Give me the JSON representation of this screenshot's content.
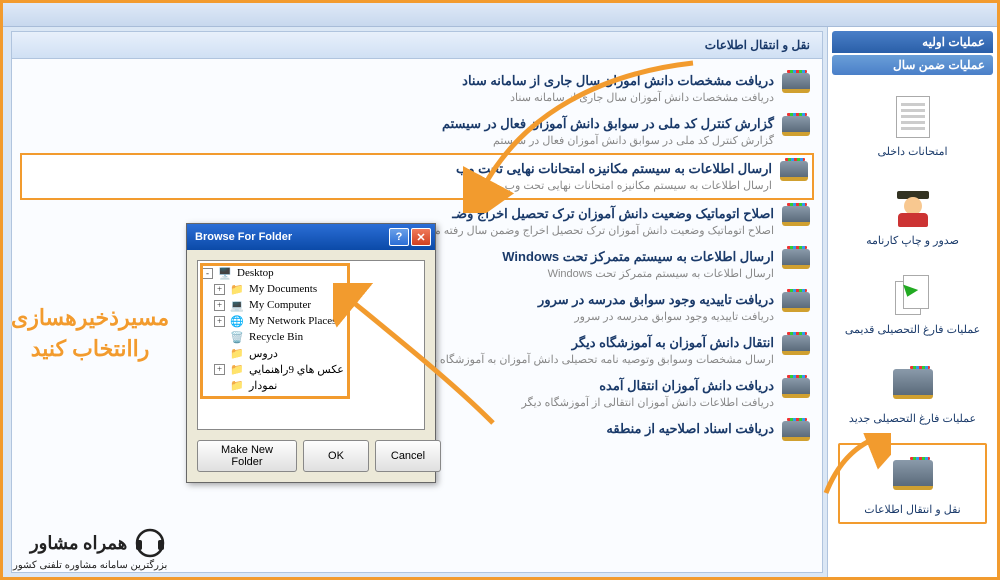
{
  "topbar": {},
  "sidebar": {
    "header1": "عملیات اولیه",
    "header2": "عملیات ضمن سال",
    "items": [
      {
        "label": "امتحانات داخلی"
      },
      {
        "label": "صدور و چاپ کارنامه"
      },
      {
        "label": "عملیات فارغ التحصیلی قدیمی"
      },
      {
        "label": "عملیات فارغ التحصیلی جدید"
      },
      {
        "label": "نقل و انتقال اطلاعات"
      }
    ]
  },
  "content": {
    "header": "نقل و انتقال اطلاعات",
    "items": [
      {
        "title": "دریافت مشخصات دانش آموزان سال جاری از سامانه سناد",
        "desc": "دریافت مشخصات دانش آموزان سال جاری از سامانه سناد"
      },
      {
        "title": "گزارش کنترل کد ملی در سوابق  دانش آموزان فعال در سیستم",
        "desc": "گزارش کنترل کد ملی در سوابق  دانش آموزان فعال در سیستم"
      },
      {
        "title": "ارسال اطلاعات به سیستم مکانیزه امتحانات نهایی تحت وب",
        "desc": "ارسال اطلاعات به سیستم مکانیزه امتحانات نهایی تحت وب"
      },
      {
        "title": "اصلاح اتوماتیک وضعیت دانش آموزان ترک تحصیل  اخراج وضـ",
        "desc": "اصلاح اتوماتیک وضعیت دانش آموزان ترک تحصیل  اخراج وضمن سال رفته مربوط به سالهای قبل"
      },
      {
        "title": "ارسال اطلاعات به سیستم متمرکز تحت Windows",
        "desc": "ارسال اطلاعات به سیستم متمرکز تحت Windows"
      },
      {
        "title": "دریافت تاییدیه وجود سوابق مدرسه در سرور",
        "desc": "دریافت تاییدیه وجود سوابق مدرسه در سرور"
      },
      {
        "title": "انتقال دانش آموزان به آموزشگاه دیگر",
        "desc": "ارسال مشخصات وسوابق وتوصیه نامه تحصیلی دانش آموزان به آموزشگاه دیگر"
      },
      {
        "title": "دریافت دانش آموزان انتقال آمده",
        "desc": "دریافت  اطلاعات دانش آموزان انتقالی از آموزشگاه دیگر"
      },
      {
        "title": "دریافت اسناد اصلاحیه از منطقه",
        "desc": ""
      }
    ]
  },
  "dialog": {
    "title": "Browse For Folder",
    "tree": [
      {
        "label": "Desktop",
        "expander": "-",
        "indent": 0,
        "icon": "desktop"
      },
      {
        "label": "My Documents",
        "expander": "+",
        "indent": 1,
        "icon": "folder"
      },
      {
        "label": "My Computer",
        "expander": "+",
        "indent": 1,
        "icon": "computer"
      },
      {
        "label": "My Network Places",
        "expander": "+",
        "indent": 1,
        "icon": "network"
      },
      {
        "label": "Recycle Bin",
        "expander": "",
        "indent": 1,
        "icon": "recycle"
      },
      {
        "label": "دروس",
        "expander": "",
        "indent": 1,
        "icon": "folder"
      },
      {
        "label": "عكس هاي 9راهنمایي",
        "expander": "+",
        "indent": 1,
        "icon": "folder"
      },
      {
        "label": "نمودار",
        "expander": "",
        "indent": 1,
        "icon": "folder"
      }
    ],
    "buttons": {
      "make": "Make New Folder",
      "ok": "OK",
      "cancel": "Cancel"
    }
  },
  "annotation": {
    "line1": "مسیرذخیرهسازی",
    "line2": "راانتخاب کنید"
  },
  "watermark": {
    "brand": "همراه مشاور",
    "tagline": "بزرگترین سامانه مشاوره تلفنی کشور"
  }
}
